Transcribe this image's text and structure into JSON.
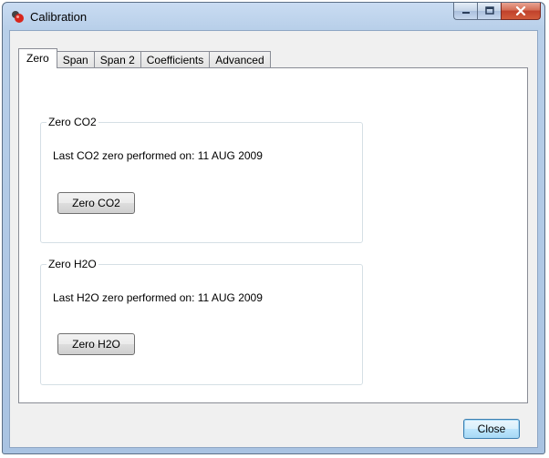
{
  "window": {
    "title": "Calibration",
    "caption_buttons": [
      "minimize",
      "maximize",
      "close"
    ]
  },
  "tabs": [
    {
      "label": "Zero",
      "active": true
    },
    {
      "label": "Span",
      "active": false
    },
    {
      "label": "Span 2",
      "active": false
    },
    {
      "label": "Coefficients",
      "active": false
    },
    {
      "label": "Advanced",
      "active": false
    }
  ],
  "zero_co2": {
    "legend": "Zero CO2",
    "last_text": "Last CO2 zero performed on:  11 AUG 2009",
    "button_label": "Zero CO2"
  },
  "zero_h2o": {
    "legend": "Zero H2O",
    "last_text": "Last H2O zero performed on:  11 AUG 2009",
    "button_label": "Zero H2O"
  },
  "footer": {
    "close_label": "Close"
  },
  "colors": {
    "frame": "#a9c3e2",
    "client": "#f0f0f0",
    "close_caption": "#c0412b",
    "default_button": "#3c7fb1"
  }
}
